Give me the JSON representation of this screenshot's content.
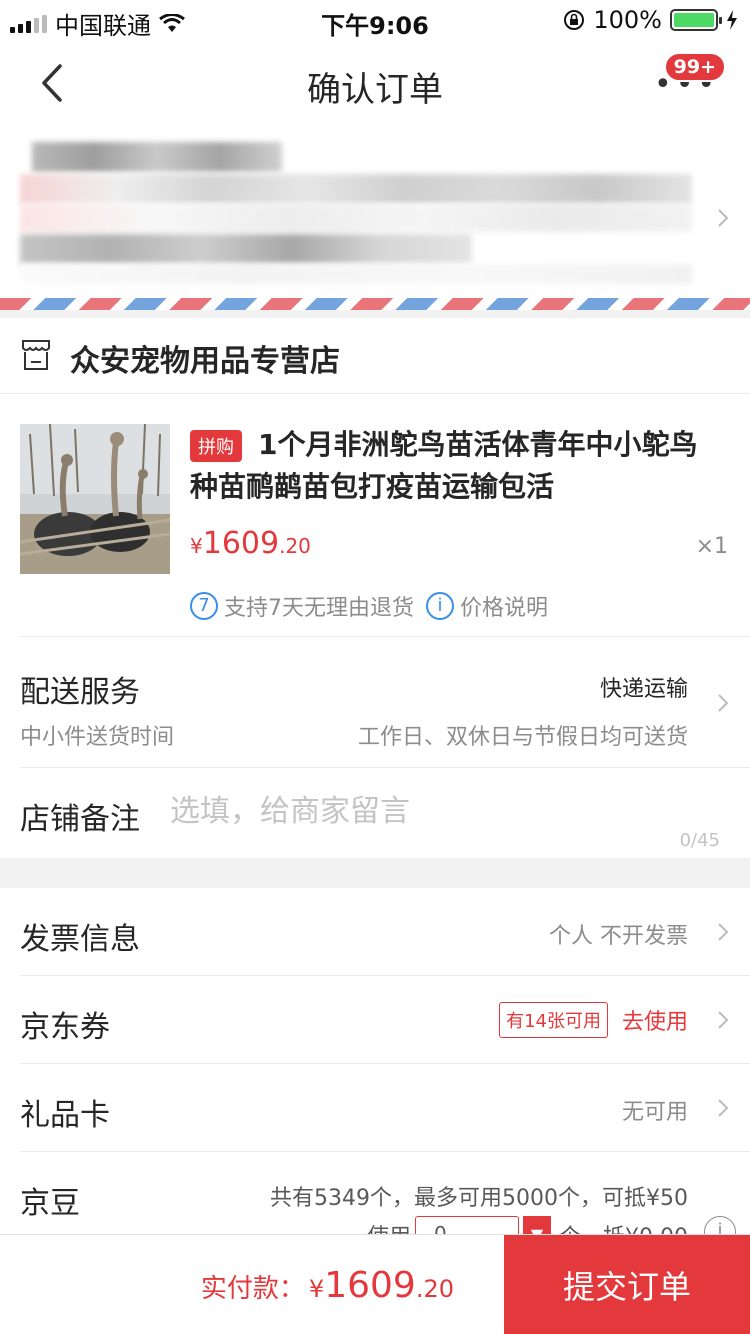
{
  "status_bar": {
    "carrier": "中国联通",
    "time": "下午9:06",
    "battery": "100%"
  },
  "nav": {
    "title": "确认订单",
    "badge": "99+"
  },
  "store": {
    "name": "众安宠物用品专营店"
  },
  "product": {
    "tag": "拼购",
    "name": "1个月非洲鸵鸟苗活体青年中小鸵鸟种苗鸸鹋苗包打疫苗运输包活",
    "price_currency": "¥",
    "price_int": "1609",
    "price_dec": ".20",
    "quantity": "×1",
    "return_num": "7",
    "return_text": "支持7天无理由退货",
    "price_info_icon": "i",
    "price_info_text": "价格说明"
  },
  "shipping": {
    "title": "配送服务",
    "subtitle": "中小件送货时间",
    "value": "快递运输",
    "sub_value": "工作日、双休日与节假日均可送货"
  },
  "note": {
    "title": "店铺备注",
    "placeholder": "选填，给商家留言",
    "count": "0/45"
  },
  "invoice": {
    "title": "发票信息",
    "value": "个人 不开发票"
  },
  "coupon": {
    "title": "京东券",
    "tag": "有14张可用",
    "action": "去使用"
  },
  "gift_card": {
    "title": "礼品卡",
    "value": "无可用"
  },
  "beans": {
    "title": "京豆",
    "summary": "共有5349个，最多可用5000个，可抵¥50",
    "use_label": "使用",
    "input_value": "0",
    "unit_label": "个，抵¥0.00",
    "info": "i"
  },
  "footer": {
    "pay_label": "实付款：",
    "currency": "¥",
    "int": "1609",
    "dec": ".20",
    "submit": "提交订单"
  },
  "colors": {
    "accent": "#e4393c",
    "link_blue": "#3a8ee6"
  }
}
